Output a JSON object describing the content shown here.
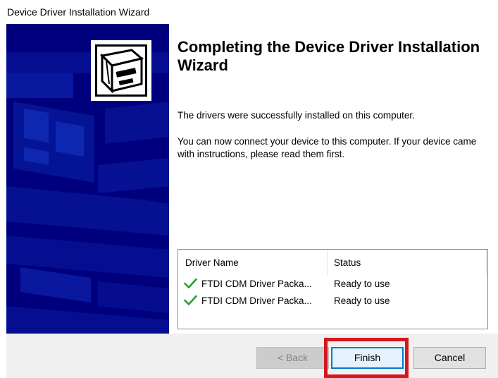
{
  "window": {
    "title": "Device Driver Installation Wizard"
  },
  "wizard": {
    "heading": "Completing the Device Driver Installation Wizard",
    "message_installed": "The drivers were successfully installed on this computer.",
    "message_connect": "You can now connect your device to this computer. If your device came with instructions, please read them first."
  },
  "driver_list": {
    "columns": [
      "Driver Name",
      "Status"
    ],
    "rows": [
      {
        "name": "FTDI CDM Driver Packa...",
        "status": "Ready to use",
        "icon": "checkmark-icon"
      },
      {
        "name": "FTDI CDM Driver Packa...",
        "status": "Ready to use",
        "icon": "checkmark-icon"
      }
    ]
  },
  "buttons": {
    "back": "< Back",
    "finish": "Finish",
    "cancel": "Cancel"
  },
  "colors": {
    "side_panel": "#00007e",
    "check_green": "#2a9d2a",
    "highlight_red": "#d4161f",
    "finish_border": "#0078d7"
  },
  "icons": {
    "wizard": "computer-hardware-icon",
    "row": "checkmark-icon"
  }
}
